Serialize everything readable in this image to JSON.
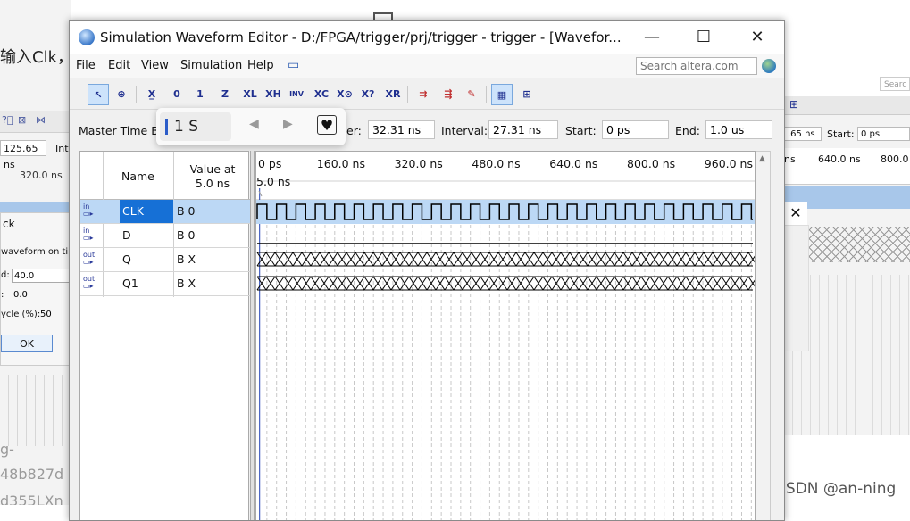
{
  "background": {
    "left_text": "输入Clk，",
    "left_field_value": "125.65 ns",
    "left_field_label": "Int",
    "left_tick": "320.0 ns",
    "left_dialog_title": "ck",
    "left_dialog_subtitle": "waveform on time",
    "left_rows": [
      {
        "label": "d:",
        "value": "40.0"
      },
      {
        "label": ":",
        "value": "0.0"
      },
      {
        "label": "ycle (%):",
        "value": "50"
      }
    ],
    "left_ok": "OK",
    "left_blur_lines": [
      "g-",
      "48b827d",
      "d355LXn"
    ],
    "right_field_value": ".65 ns",
    "right_start_label": "Start:",
    "right_start_value": "0 ps",
    "right_ticks": [
      "ns",
      "640.0 ns",
      "800.0"
    ],
    "right_search": "Searc",
    "watermark": "CSDN @an-ning"
  },
  "window": {
    "title": "Simulation Waveform Editor - D:/FPGA/trigger/prj/trigger - trigger - [Wavefor...",
    "controls": {
      "minimize": "—",
      "maximize": "☐",
      "close": "✕"
    }
  },
  "menu": {
    "items": [
      "File",
      "Edit",
      "View",
      "Simulation",
      "Help"
    ],
    "search_placeholder": "Search altera.com"
  },
  "toolbar": {
    "buttons": [
      "select-tool",
      "zoom-tool",
      "uninitialized",
      "force-low",
      "force-high",
      "high-impedance",
      "weak-low",
      "weak-high",
      "invert",
      "count-value",
      "clock",
      "arbitrary-value",
      "random-values",
      "functional-sim",
      "timing-sim",
      "edit-sim",
      "snap-to-grid",
      "group"
    ]
  },
  "timebar": {
    "master_label": "Master Time Ba",
    "pointer_label": "er:",
    "pointer_value": "32.31 ns",
    "interval_label": "Interval:",
    "interval_value": "27.31 ns",
    "start_label": "Start:",
    "start_value": "0 ps",
    "end_label": "End:",
    "end_value": "1.0 us"
  },
  "popup": {
    "value": "1 S",
    "prev": "◀",
    "next": "▶",
    "heart": "♥"
  },
  "nodes": {
    "header_name": "Name",
    "header_value_line1": "Value at",
    "header_value_line2": "5.0 ns",
    "rows": [
      {
        "dir": "in",
        "name": "CLK",
        "value": "B 0"
      },
      {
        "dir": "in",
        "name": "D",
        "value": "B 0"
      },
      {
        "dir": "out",
        "name": "Q",
        "value": "B X"
      },
      {
        "dir": "out",
        "name": "Q1",
        "value": "B X"
      }
    ]
  },
  "waveform": {
    "time_marker": "5.0 ns",
    "ruler_ticks": [
      "0 ps",
      "160.0 ns",
      "320.0 ns",
      "480.0 ns",
      "640.0 ns",
      "800.0 ns",
      "960.0 ns"
    ],
    "clock_period_ns": 40,
    "time_range_ns": [
      0,
      1000
    ],
    "selected_row": "CLK",
    "colors": {
      "selected_row": "#bcd8f5",
      "wave": "#000000",
      "grid": "#c8c8c8",
      "marker": "#1f3fb5"
    }
  }
}
